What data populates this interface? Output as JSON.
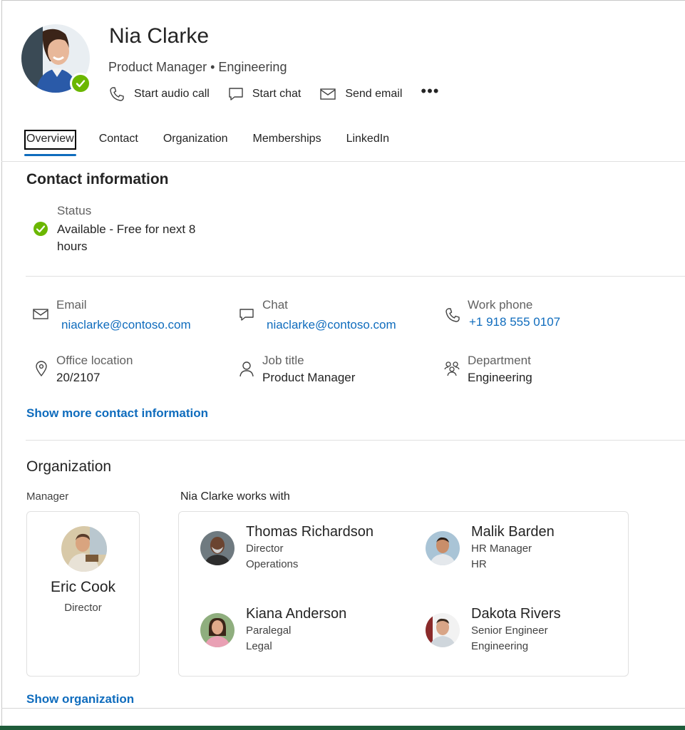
{
  "profile": {
    "name": "Nia Clarke",
    "subtitle": "Product Manager • Engineering",
    "presence_color": "#6bb700"
  },
  "actions": [
    {
      "icon": "phone-icon",
      "label": "Start audio call"
    },
    {
      "icon": "chat-icon",
      "label": "Start chat"
    },
    {
      "icon": "mail-icon",
      "label": "Send email"
    }
  ],
  "more_label": "•••",
  "tabs": [
    {
      "label": "Overview",
      "active": true
    },
    {
      "label": "Contact"
    },
    {
      "label": "Organization"
    },
    {
      "label": "Memberships"
    },
    {
      "label": "LinkedIn"
    }
  ],
  "contact": {
    "title": "Contact information",
    "status_label": "Status",
    "status_value": "Available - Free for next 8 hours",
    "email_label": "Email",
    "email_value": "niaclarke@contoso.com",
    "chat_label": "Chat",
    "chat_value": "niaclarke@contoso.com",
    "phone_label": "Work phone",
    "phone_value": "+1 918 555 0107",
    "office_label": "Office location",
    "office_value": "20/2107",
    "job_label": "Job title",
    "job_value": "Product Manager",
    "dept_label": "Department",
    "dept_value": "Engineering",
    "show_more": "Show more contact information"
  },
  "organization": {
    "title": "Organization",
    "manager_label": "Manager",
    "manager_name": "Eric Cook",
    "manager_title": "Director",
    "works_with_label": "Nia Clarke works with",
    "colleagues": [
      {
        "name": "Thomas Richardson",
        "title": "Director",
        "dept": "Operations"
      },
      {
        "name": "Malik Barden",
        "title": "HR Manager",
        "dept": "HR"
      },
      {
        "name": "Kiana Anderson",
        "title": "Paralegal",
        "dept": "Legal"
      },
      {
        "name": "Dakota Rivers",
        "title": "Senior Engineer",
        "dept": "Engineering"
      }
    ],
    "show_org": "Show organization"
  },
  "colors": {
    "accent": "#0f6cbd",
    "available": "#6bb700"
  }
}
